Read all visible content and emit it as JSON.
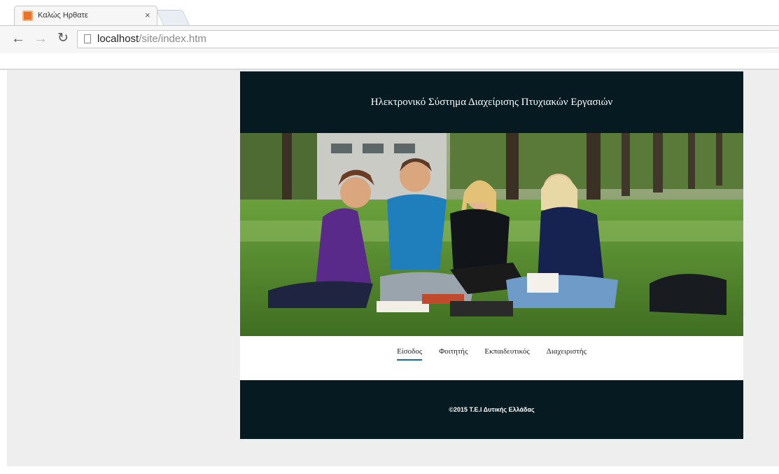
{
  "browser": {
    "tab_title": "Καλώς Ηρθατε",
    "tab_close": "×",
    "url_host": "localhost",
    "url_path": "/site/index.htm",
    "icons": [
      "back-arrow-icon",
      "forward-arrow-icon",
      "reload-icon",
      "page-icon",
      "favicon-icon",
      "close-icon"
    ]
  },
  "site": {
    "header_title": "Ηλεκτρονικό Σύστημα Διαχείρισης Πτυχιακών Εργασιών",
    "menu": [
      {
        "label": "Είσοδος",
        "active": true
      },
      {
        "label": "Φοιτητής",
        "active": false
      },
      {
        "label": "Εκπαιδευτικός",
        "active": false
      },
      {
        "label": "Διαχειριστής",
        "active": false
      }
    ],
    "footer_text": "©2015 Τ.Ε.Ι Δυτικής Ελλάδας"
  },
  "colors": {
    "header_bg": "#061a22",
    "active_underline": "#1a6b9e",
    "favicon": "#e8722c"
  }
}
